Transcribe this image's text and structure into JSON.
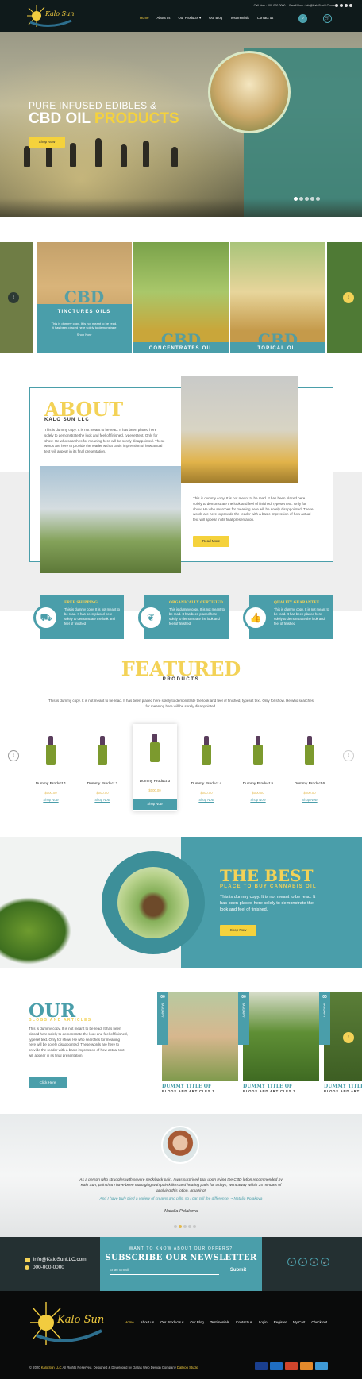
{
  "header": {
    "brand": "Kalo Sun",
    "call": "Call Now : 000-000-0000",
    "email": "Email Now : info@KaloSunLLC.com",
    "nav": [
      "Home",
      "About us",
      "Our Products",
      "Our Blog",
      "Testimonials",
      "Contact us"
    ]
  },
  "hero": {
    "line1": "PURE INFUSED EDIBLES &",
    "line2a": "CBD OIL ",
    "line2b": "PRODUCTS",
    "cta": "Shop Now"
  },
  "categories": [
    {
      "word": "CBD",
      "name": "TINCTURES OILS",
      "text": "This is dummy copy. It is not meant to be read. It has been placed here solely to demonstrate",
      "link": "Shop Now"
    },
    {
      "word": "CBD",
      "name": "CONCENTRATES OIL"
    },
    {
      "word": "CBD",
      "name": "TOPICAL OIL"
    }
  ],
  "about": {
    "title": "ABOUT",
    "subtitle": "KALO SUN LLC",
    "p1": "This is dummy copy. It is not meant to be read. It has been placed here solely to demonstrate the look and feel of finished, typeset text. Only for show. He who searches for meaning here will be sorely disappointed. These words are here to provide the reader with a basic impression of how actual text will appear in its final presentation.",
    "p2": "This is dummy copy. It is not meant to be read. It has been placed here solely to demonstrate the look and feel of finished, typeset text. Only for show. He who searches for meaning here will be sorely disappointed. These words are here to provide the reader with a basic impression of how actual text will appear in its final presentation.",
    "cta": "Read More"
  },
  "features": [
    {
      "title": "FREE SHIPPING",
      "text": "This is dummy copy. It is not meant to be read. It has been placed here solely to demonstrate the look and feel of finished"
    },
    {
      "title": "ORGANICALLY CERTIFIED",
      "text": "This is dummy copy. It is not meant to be read. It has been placed here solely to demonstrate the look and feel of finished"
    },
    {
      "title": "QUALITY GUARANTEE",
      "text": "This is dummy copy. It is not meant to be read. It has been placed here solely to demonstrate the look and feel of finished"
    }
  ],
  "featured": {
    "title": "FEATURED",
    "subtitle": "PRODUCTS",
    "desc": "This is dummy copy. It is not meant to be read. It has been placed here solely to demonstrate the look and feel of finished, typeset text. Only for show. He who searches for meaning here will be sorely disappointed.",
    "products": [
      {
        "name": "Dummy Product 1",
        "price": "$000.00",
        "link": "Shop Now"
      },
      {
        "name": "Dummy Product 2",
        "price": "$000.00",
        "link": "Shop Now"
      },
      {
        "name": "Dummy Product 3",
        "price": "$000.00",
        "link": "Shop Now"
      },
      {
        "name": "Dummy Product 4",
        "price": "$000.00",
        "link": "Shop Now"
      },
      {
        "name": "Dummy Product 5",
        "price": "$000.00",
        "link": "Shop Now"
      },
      {
        "name": "Dummy Product 6",
        "price": "$000.00",
        "link": "Shop Now"
      }
    ]
  },
  "best": {
    "title": "THE BEST",
    "subtitle": "PLACE TO BUY CANNABIS OIL",
    "text": "This is dummy copy. It is not meant to be read. It has been placed here solely to demonstrate the look and feel of finished.",
    "cta": "Shop Now"
  },
  "blogs": {
    "title": "OUR",
    "subtitle": "BLOGS AND ARTICLES",
    "text": "This is dummy copy. It is not meant to be read. It has been placed here solely to demonstrate the look and feel of finished, typeset text. Only for show. He who searches for meaning here will be sorely disappointed. These words are here to provide the reader with a basic impression of how actual text will appear in its final presentation.",
    "cta": "Click Here",
    "items": [
      {
        "day": "00",
        "month": "JANUARY",
        "title": "DUMMY TITLE OF",
        "sub": "BLOGS AND ARTICLES 1"
      },
      {
        "day": "00",
        "month": "JANUARY",
        "title": "DUMMY TITLE OF",
        "sub": "BLOGS AND ARTICLES 2"
      },
      {
        "day": "00",
        "month": "JANUARY",
        "title": "DUMMY TITLE O",
        "sub": "BLOGS AND ART"
      }
    ]
  },
  "testimonial": {
    "quote": "As a person who struggles with severe neck/back pain, I was surprised that upon trying the CBD lotion recommended by Kalo Sun, pain that I have been managing with pain killers and heating pads for 4 days, went away within 15 minutes of applying this lotion. Amazing!",
    "quote2": "And I have truly tried a variety of creams and pills, so I can tell the difference. ~ Natalia Polakova",
    "name": "Natalia Polakova"
  },
  "newsletter": {
    "small": "WANT TO KNOW ABOUT OUR OFFERS?",
    "title": "SUBSCRIBE OUR NEWSLETTER",
    "placeholder": "Enter Email",
    "submit": "Submit",
    "email": "info@KaloSunLLC.com",
    "phone": "000-000-0000"
  },
  "footer": {
    "brand": "Kalo Sun",
    "nav": [
      "Home",
      "About us",
      "Our Products",
      "Our Blog",
      "Testimonials",
      "Contact us",
      "Login",
      "Register",
      "My Cart",
      "Check out"
    ],
    "copy_pre": "© 2020 ",
    "copy_brand": "Kalo Sun LLC",
    "copy_mid": " All Rights Reserved. Designed & Developed by Dallas Web Design Company ",
    "copy_studio": "Dallkoo Studio"
  },
  "colors": {
    "teal": "#4a9eaa",
    "yellow": "#f3d257",
    "dark": "#0f1a1b"
  }
}
